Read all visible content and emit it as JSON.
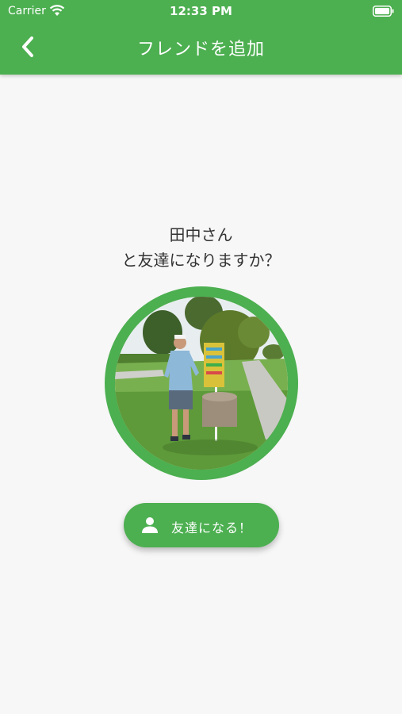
{
  "status_bar": {
    "carrier": "Carrier",
    "time": "12:33 PM"
  },
  "header": {
    "title": "フレンドを追加",
    "back_icon": "chevron-left-icon"
  },
  "prompt": {
    "name_line": "田中さん",
    "question_line": "と友達になりますか？"
  },
  "avatar": {
    "description_icon": "profile-photo"
  },
  "friend_button": {
    "label": "友達になる！",
    "icon": "person-icon"
  },
  "colors": {
    "primary": "#4caf50",
    "background": "#f7f7f7",
    "text": "#333333"
  }
}
